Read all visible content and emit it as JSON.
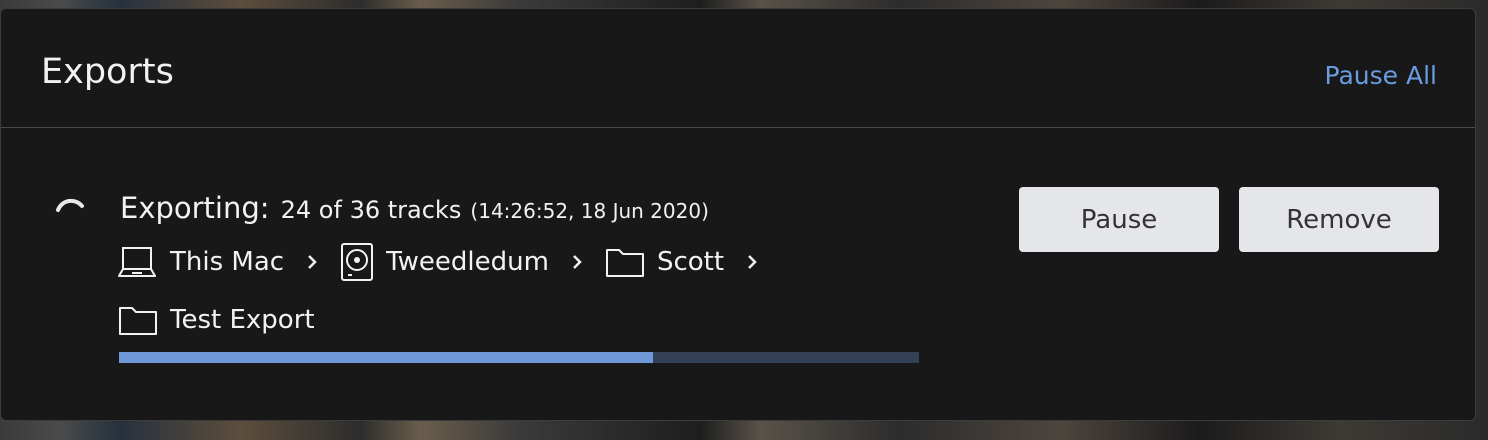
{
  "modal": {
    "title": "Exports",
    "pause_all_label": "Pause All"
  },
  "export": {
    "status_label": "Exporting:",
    "progress_text": "24 of 36 tracks",
    "timestamp": "(14:26:52, 18 Jun 2020)",
    "tracks_done": 24,
    "tracks_total": 36,
    "progress_fraction": 0.667,
    "path": [
      {
        "icon": "laptop-icon",
        "label": "This Mac"
      },
      {
        "icon": "hard-drive-icon",
        "label": "Tweedledum"
      },
      {
        "icon": "folder-icon",
        "label": "Scott"
      },
      {
        "icon": "folder-icon",
        "label": "Test Export"
      }
    ],
    "pause_label": "Pause",
    "remove_label": "Remove"
  },
  "colors": {
    "accent": "#6b9be0",
    "progress_fill": "#6f98d8",
    "progress_track": "#334055",
    "background": "#181818",
    "button_bg": "#e4e6ea"
  }
}
